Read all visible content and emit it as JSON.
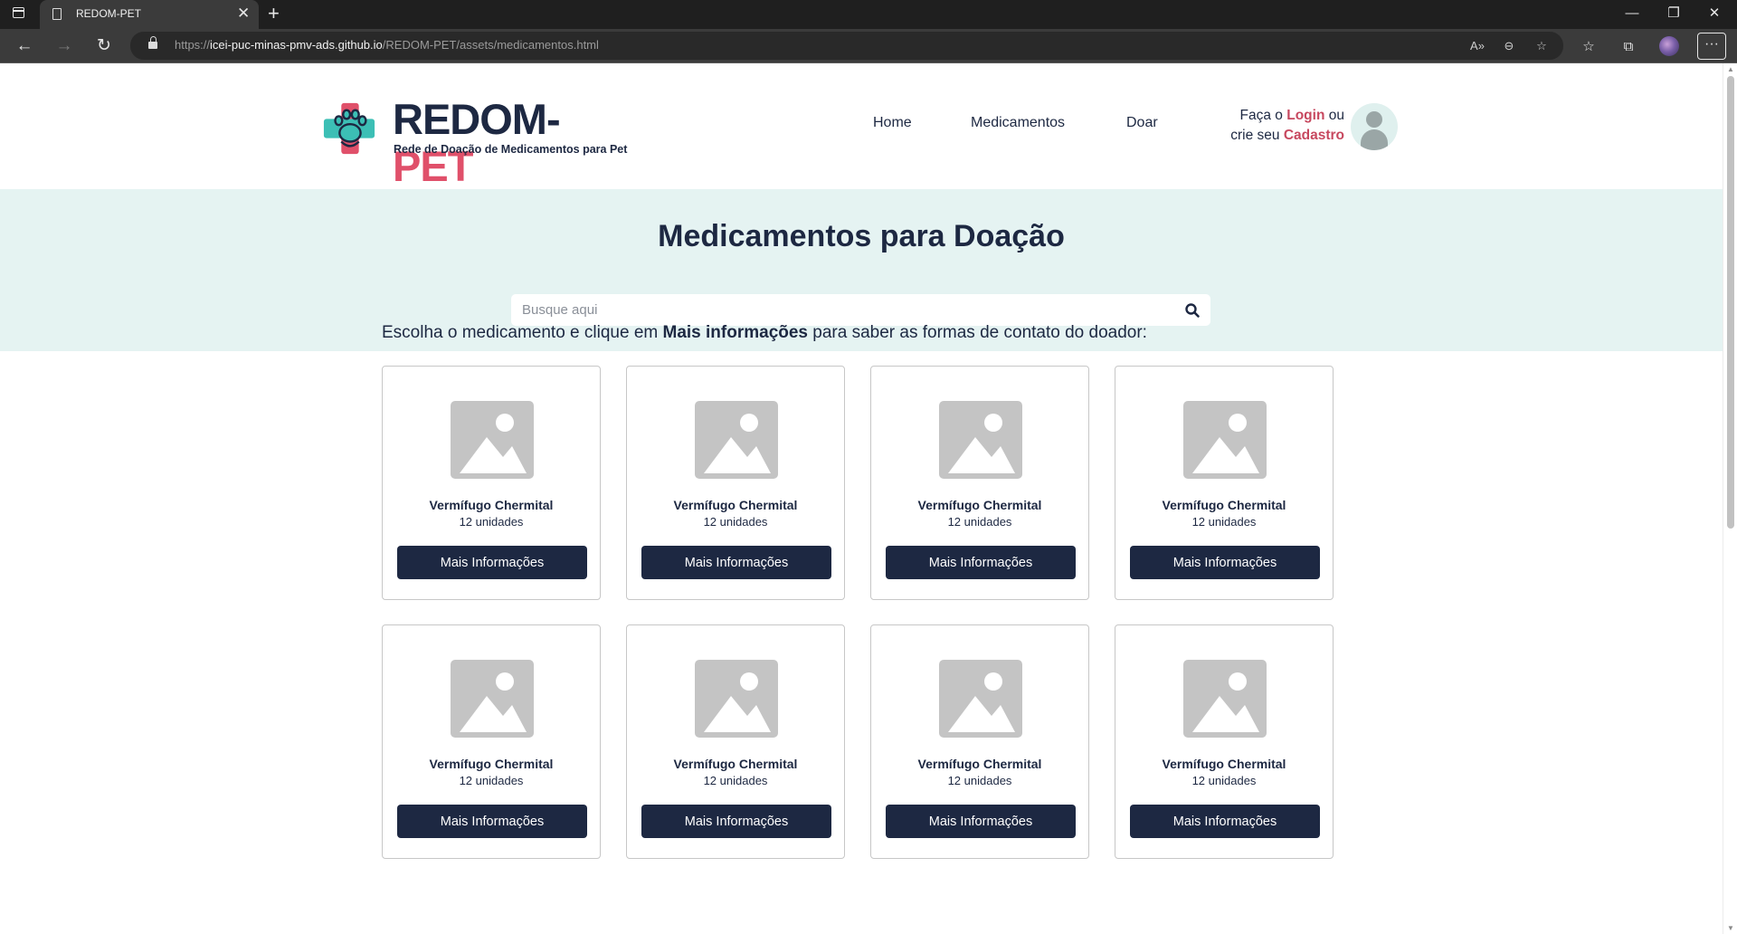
{
  "browser": {
    "tab_title": "REDOM-PET",
    "url_prefix": "https://",
    "url_host": "icei-puc-minas-pmv-ads.github.io",
    "url_path": "/REDOM-PET/assets/medicamentos.html"
  },
  "site": {
    "logo_title_part1": "REDOM-",
    "logo_title_part2": "PET",
    "logo_subtitle": "Rede de Doação de Medicamentos para Pet",
    "nav": {
      "home": "Home",
      "medicamentos": "Medicamentos",
      "doar": "Doar"
    },
    "login": {
      "prefix": "Faça o",
      "login_link": "Login",
      "middle": "ou",
      "line2_prefix": "crie seu",
      "register_link": "Cadastro"
    },
    "colors": {
      "navy": "#1d2842",
      "accent": "#e0506a",
      "hero_bg": "#e5f3f2"
    }
  },
  "hero": {
    "title": "Medicamentos para Doação",
    "search_placeholder": "Busque aqui"
  },
  "intro": {
    "before": "Escolha o medicamento e clique em ",
    "bold": "Mais informações",
    "after": " para saber as formas de contato do doador:"
  },
  "cards": [
    {
      "name": "Vermífugo Chermital",
      "qty": "12 unidades",
      "button": "Mais Informações"
    },
    {
      "name": "Vermífugo Chermital",
      "qty": "12 unidades",
      "button": "Mais Informações"
    },
    {
      "name": "Vermífugo Chermital",
      "qty": "12 unidades",
      "button": "Mais Informações"
    },
    {
      "name": "Vermífugo Chermital",
      "qty": "12 unidades",
      "button": "Mais Informações"
    },
    {
      "name": "Vermífugo Chermital",
      "qty": "12 unidades",
      "button": "Mais Informações"
    },
    {
      "name": "Vermífugo Chermital",
      "qty": "12 unidades",
      "button": "Mais Informações"
    },
    {
      "name": "Vermífugo Chermital",
      "qty": "12 unidades",
      "button": "Mais Informações"
    },
    {
      "name": "Vermífugo Chermital",
      "qty": "12 unidades",
      "button": "Mais Informações"
    }
  ]
}
